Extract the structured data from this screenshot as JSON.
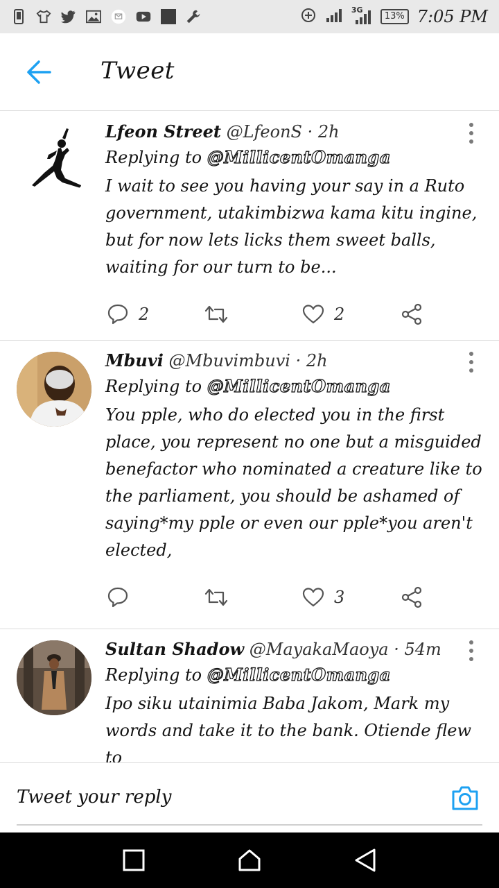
{
  "status_bar": {
    "battery": "13%",
    "time": "7:05 PM",
    "network": "3G",
    "icons": [
      "phone-icon",
      "tshirt-icon",
      "twitter-icon",
      "image-icon",
      "mail-icon",
      "youtube-icon",
      "app-icon",
      "wrench-icon"
    ]
  },
  "header": {
    "title": "Tweet",
    "back_icon": "arrow-left-icon",
    "accent_color": "#1da1f2"
  },
  "tweets": [
    {
      "name": "Lfeon Street",
      "handle": "@LfeonS",
      "time": "· 2h",
      "replying_label": "Replying to",
      "mention": "@MillicentOmanga",
      "text": "I wait to see you having your say in a Ruto government, utakimbizwa kama kitu ingine, but for now lets licks them sweet balls, waiting for our turn to be...",
      "replies": "2",
      "retweets": "",
      "likes": "2",
      "avatar": "jumpman-silhouette"
    },
    {
      "name": "Mbuvi",
      "handle": "@Mbuvimbuvi",
      "time": "· 2h",
      "replying_label": "Replying to",
      "mention": "@MillicentOmanga",
      "text": "You pple, who do elected you in the first place, you represent no one but a misguided benefactor who nominated a creature like to the parliament, you should be ashamed of saying*my pple or even our pple*you aren't elected,",
      "replies": "",
      "retweets": "",
      "likes": "3",
      "avatar": "man-photo"
    },
    {
      "name": "Sultan Shadow",
      "handle": "@MayakaMaoya",
      "time": "· 54m",
      "replying_label": "Replying to",
      "mention": "@MillicentOmanga",
      "text": "Ipo siku utainimia Baba Jakom, Mark my words and take it to the bank.  Otiende flew to",
      "replies": "",
      "retweets": "",
      "likes": "",
      "avatar": "man-in-coat-photo"
    }
  ],
  "composer": {
    "placeholder": "Tweet your reply",
    "camera_icon": "camera-icon"
  },
  "nav": [
    "recents-icon",
    "home-icon",
    "back-icon"
  ]
}
